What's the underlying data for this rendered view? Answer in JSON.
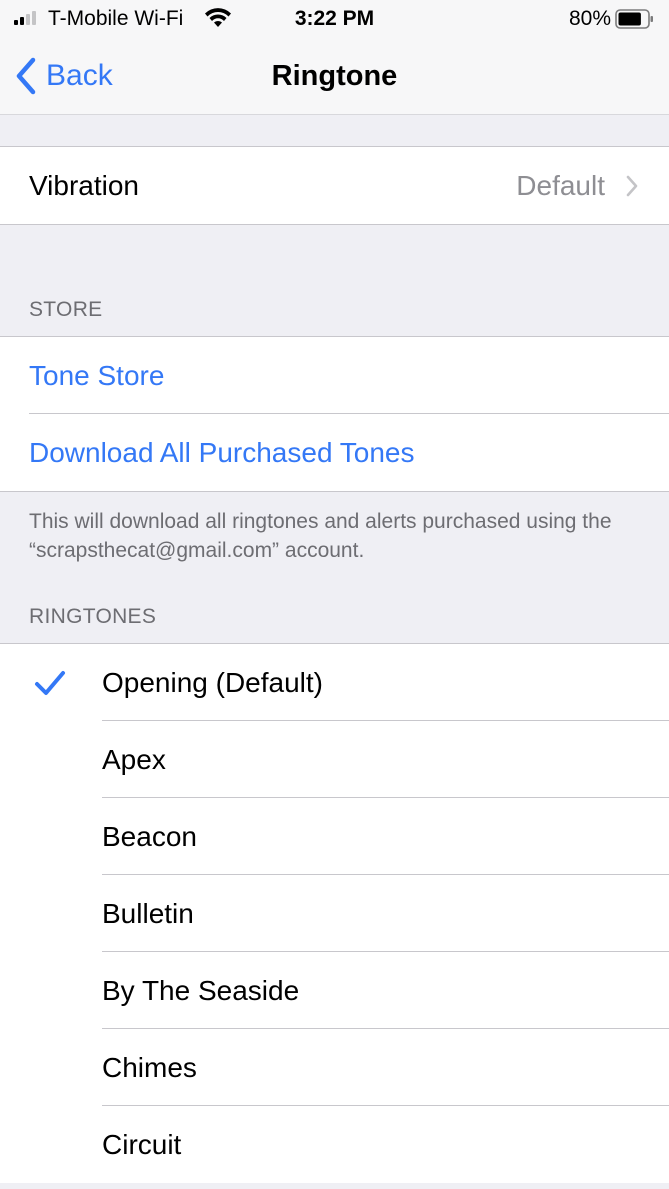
{
  "status_bar": {
    "carrier": "T-Mobile Wi-Fi",
    "time": "3:22 PM",
    "battery_percent": "80%",
    "battery_level": 0.8,
    "signal_bars": 2
  },
  "nav": {
    "back_label": "Back",
    "title": "Ringtone"
  },
  "vibration": {
    "label": "Vibration",
    "value": "Default"
  },
  "store": {
    "header": "STORE",
    "items": [
      "Tone Store",
      "Download All Purchased Tones"
    ],
    "footer": "This will download all ringtones and alerts purchased using the “scrapsthecat@gmail.com” account."
  },
  "ringtones": {
    "header": "RINGTONES",
    "items": [
      "Opening (Default)",
      "Apex",
      "Beacon",
      "Bulletin",
      "By The Seaside",
      "Chimes",
      "Circuit"
    ],
    "selected": "Opening (Default)"
  },
  "colors": {
    "accent": "#3478f6",
    "background": "#efeff4",
    "secondary_text": "#8e8e93"
  }
}
